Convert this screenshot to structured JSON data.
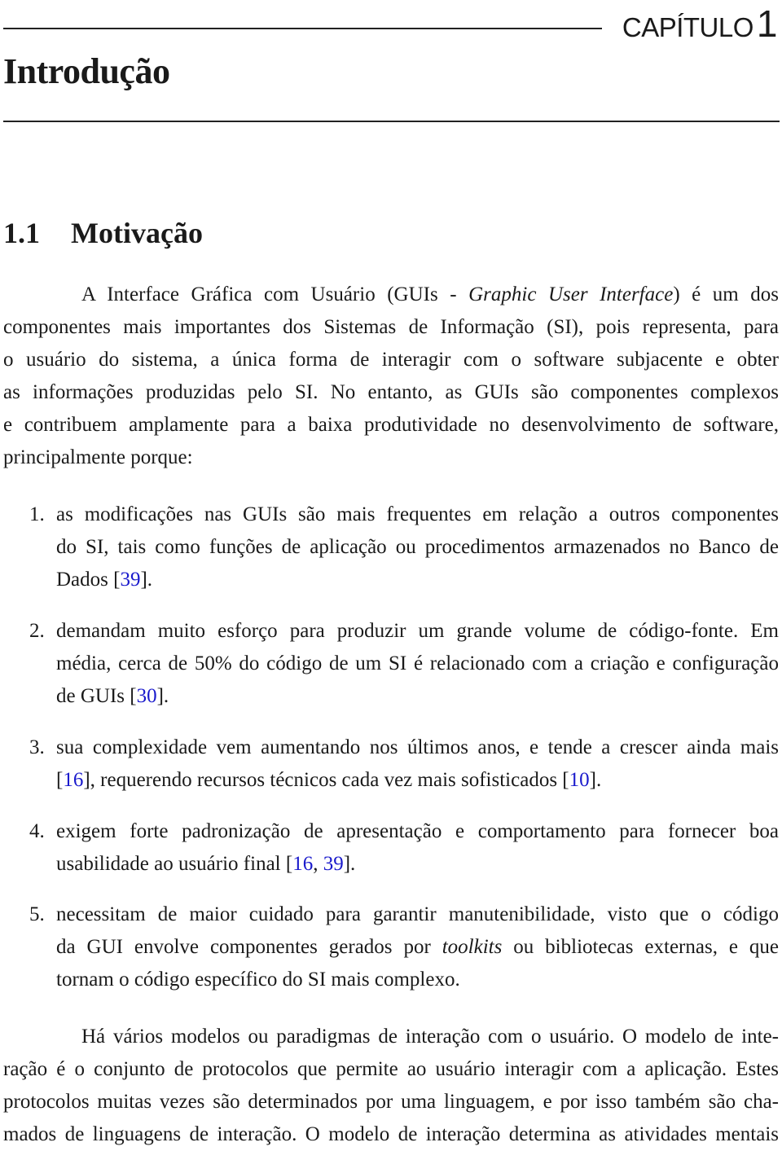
{
  "header": {
    "chapter_word": "CAPÍTULO",
    "chapter_number": "1",
    "chapter_title": "Introdução"
  },
  "section": {
    "number": "1.1",
    "title": "Motivação"
  },
  "colors": {
    "citation": "#1a1acc",
    "text": "#1a1a1a"
  },
  "paragraph1": [
    [
      {
        "t": "A Interface Gráfica com Usuário (GUIs - "
      },
      {
        "t": "Graphic User Interface",
        "s": "i"
      },
      {
        "t": ") é um dos"
      }
    ],
    [
      {
        "t": "componentes mais importantes dos Sistemas de Informação (SI), pois representa, para"
      }
    ],
    [
      {
        "t": "o usuário do sistema, a única forma de interagir com o software subjacente e obter"
      }
    ],
    [
      {
        "t": "as informações produzidas pelo SI. No entanto, as GUIs são componentes complexos"
      }
    ],
    [
      {
        "t": "e contribuem amplamente para a baixa produtividade no desenvolvimento de software,"
      }
    ],
    [
      {
        "t": "principalmente porque:"
      }
    ]
  ],
  "list": [
    {
      "marker": "1.",
      "lines": [
        [
          {
            "t": "as modificações nas GUIs são mais frequentes em relação a outros componentes"
          }
        ],
        [
          {
            "t": "do SI, tais como funções de aplicação ou procedimentos armazenados no Banco de"
          }
        ],
        [
          {
            "t": "Dados ["
          },
          {
            "t": "39",
            "s": "cite"
          },
          {
            "t": "]."
          }
        ]
      ]
    },
    {
      "marker": "2.",
      "lines": [
        [
          {
            "t": "demandam muito esforço para produzir um grande volume de código-fonte. Em"
          }
        ],
        [
          {
            "t": "média, cerca de 50% do código de um SI é relacionado com a criação e configuração"
          }
        ],
        [
          {
            "t": "de GUIs ["
          },
          {
            "t": "30",
            "s": "cite"
          },
          {
            "t": "]."
          }
        ]
      ]
    },
    {
      "marker": "3.",
      "lines": [
        [
          {
            "t": "sua complexidade vem aumentando nos últimos anos, e tende a crescer ainda mais"
          }
        ],
        [
          {
            "t": "["
          },
          {
            "t": "16",
            "s": "cite"
          },
          {
            "t": "], requerendo recursos técnicos cada vez mais sofisticados ["
          },
          {
            "t": "10",
            "s": "cite"
          },
          {
            "t": "]."
          }
        ]
      ]
    },
    {
      "marker": "4.",
      "lines": [
        [
          {
            "t": "exigem forte padronização de apresentação e comportamento para fornecer boa"
          }
        ],
        [
          {
            "t": "usabilidade ao usuário final ["
          },
          {
            "t": "16",
            "s": "cite"
          },
          {
            "t": ", "
          },
          {
            "t": "39",
            "s": "cite"
          },
          {
            "t": "]."
          }
        ]
      ]
    },
    {
      "marker": "5.",
      "lines": [
        [
          {
            "t": "necessitam de maior cuidado para garantir manutenibilidade, visto que o código"
          }
        ],
        [
          {
            "t": "da GUI envolve componentes gerados por "
          },
          {
            "t": "toolkits",
            "s": "i"
          },
          {
            "t": " ou bibliotecas externas, e que"
          }
        ],
        [
          {
            "t": "tornam o código específico do SI mais complexo."
          }
        ]
      ]
    }
  ],
  "paragraph2": [
    [
      {
        "t": "Há vários modelos ou paradigmas de interação com o usuário. O modelo de inte-"
      }
    ],
    [
      {
        "t": "ração é o conjunto de protocolos que permite ao usuário interagir com a aplicação. Estes"
      }
    ],
    [
      {
        "t": "protocolos muitas vezes são determinados por uma linguagem, e por isso também são cha-"
      }
    ],
    [
      {
        "t": "mados de linguagens de interação. O modelo de interação determina as atividades mentais"
      }
    ]
  ]
}
